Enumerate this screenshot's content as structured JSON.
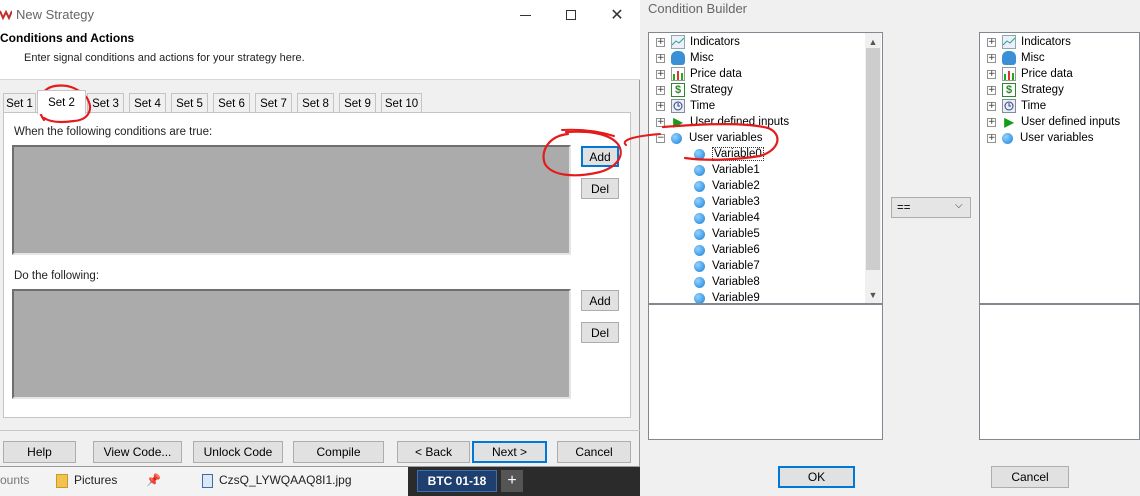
{
  "left_window": {
    "title": "New Strategy",
    "header_title": "Conditions and Actions",
    "header_subtitle": "Enter signal conditions and actions for your strategy here.",
    "tabs": [
      "Set 1",
      "Set 2",
      "Set 3",
      "Set 4",
      "Set 5",
      "Set 6",
      "Set 7",
      "Set 8",
      "Set 9",
      "Set 10"
    ],
    "active_tab": "Set 2",
    "conditions_label": "When the following conditions are true:",
    "actions_label": "Do the following:",
    "add_label": "Add",
    "del_label": "Del",
    "footer_buttons": {
      "help": "Help",
      "view_code": "View Code...",
      "unlock_code": "Unlock Code",
      "compile": "Compile",
      "back": "< Back",
      "next": "Next >",
      "cancel": "Cancel"
    }
  },
  "background": {
    "left_text": "ounts",
    "pictures": "Pictures",
    "file": "CzsQ_LYWQAAQ8I1.jpg",
    "btc": "BTC 01-18",
    "plus": "+"
  },
  "condition_builder": {
    "title": "Condition Builder",
    "left_tree": [
      {
        "label": "Indicators",
        "icon": "chart-icon",
        "expander": "+"
      },
      {
        "label": "Misc",
        "icon": "database-icon",
        "expander": "+"
      },
      {
        "label": "Price data",
        "icon": "bar-chart-icon",
        "expander": "+"
      },
      {
        "label": "Strategy",
        "icon": "dollar-icon",
        "expander": "+"
      },
      {
        "label": "Time",
        "icon": "clock-icon",
        "expander": "+"
      },
      {
        "label": "User defined inputs",
        "icon": "play-icon",
        "expander": "+"
      },
      {
        "label": "User variables",
        "icon": "ball-icon",
        "expander": "−"
      }
    ],
    "variables": [
      "Variable0",
      "Variable1",
      "Variable2",
      "Variable3",
      "Variable4",
      "Variable5",
      "Variable6",
      "Variable7",
      "Variable8",
      "Variable9"
    ],
    "selected_variable": "Variable0",
    "right_tree": [
      {
        "label": "Indicators",
        "icon": "chart-icon",
        "expander": "+"
      },
      {
        "label": "Misc",
        "icon": "database-icon",
        "expander": "+"
      },
      {
        "label": "Price data",
        "icon": "bar-chart-icon",
        "expander": "+"
      },
      {
        "label": "Strategy",
        "icon": "dollar-icon",
        "expander": "+"
      },
      {
        "label": "Time",
        "icon": "clock-icon",
        "expander": "+"
      },
      {
        "label": "User defined inputs",
        "icon": "play-icon",
        "expander": "+"
      },
      {
        "label": "User variables",
        "icon": "ball-icon",
        "expander": "+"
      }
    ],
    "operator": "==",
    "ok_label": "OK",
    "cancel_label": "Cancel"
  },
  "colors": {
    "annotation": "#e31b1b",
    "highlight": "#0078d7"
  }
}
